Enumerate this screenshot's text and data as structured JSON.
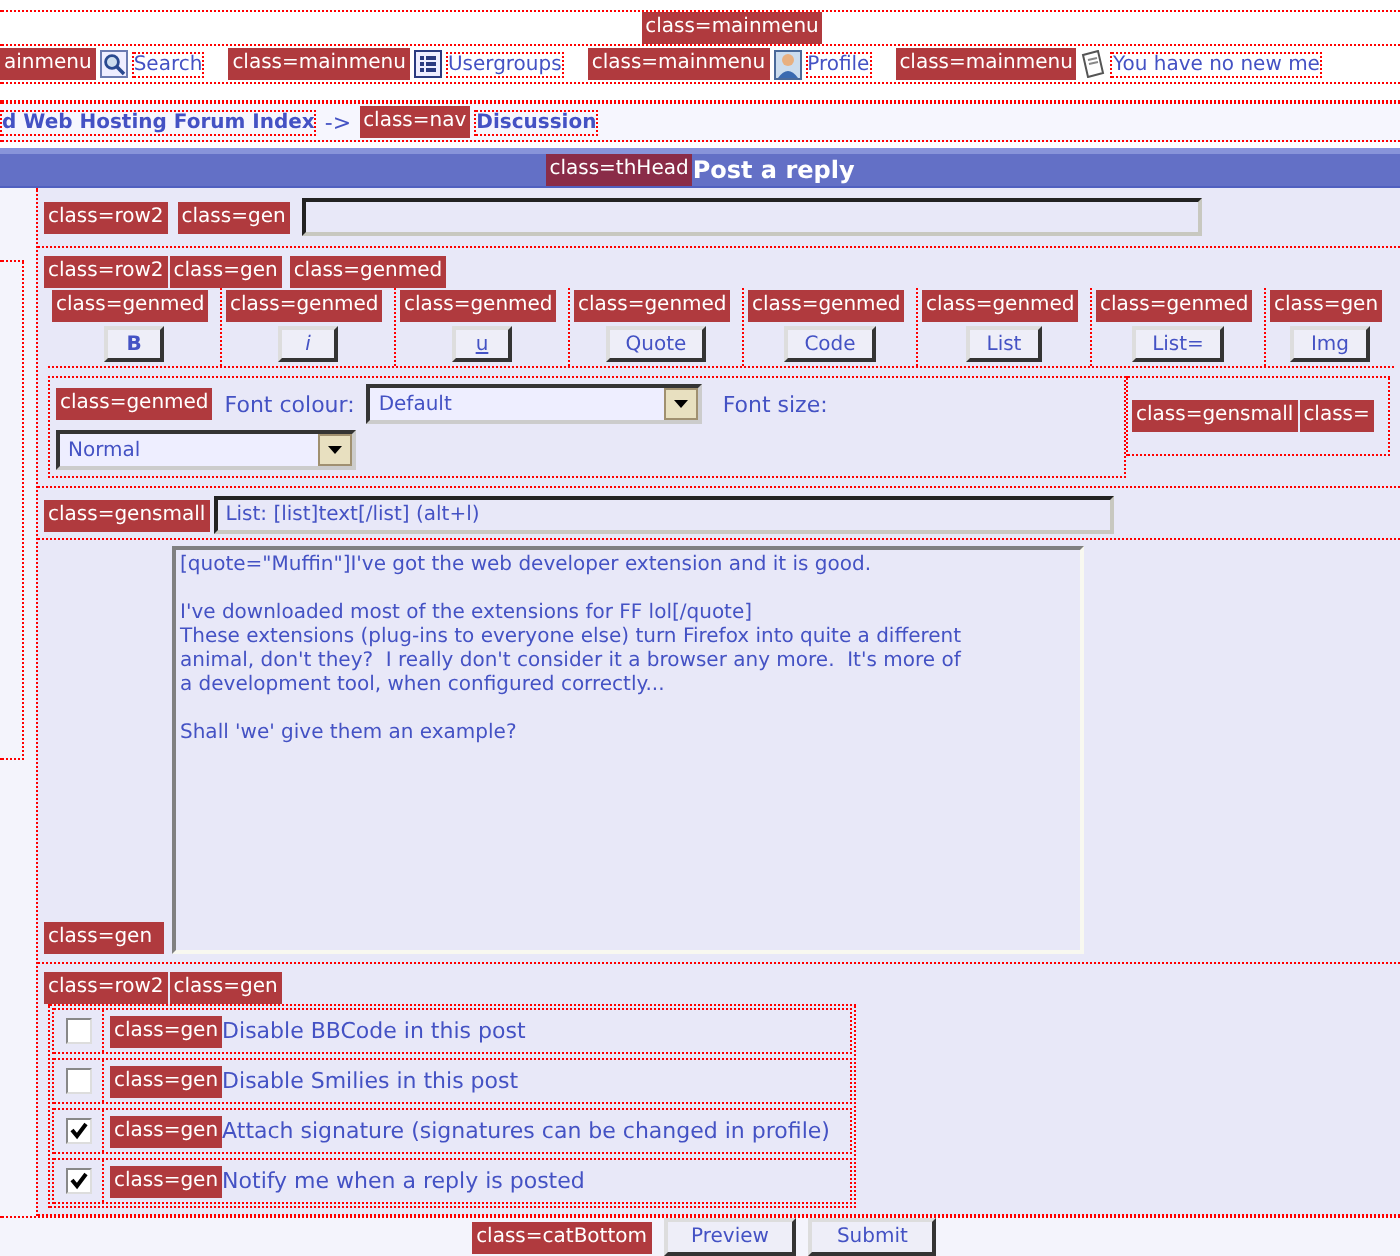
{
  "mainmenu_tag": "class=mainmenu",
  "menu_items": [
    {
      "tag": "ainmenu",
      "kind": "search",
      "text": "Search"
    },
    {
      "tag": "class=mainmenu",
      "kind": "groups",
      "text": "Usergroups"
    },
    {
      "tag": "class=mainmenu",
      "kind": "profile",
      "text": "Profile"
    },
    {
      "tag": "class=mainmenu",
      "kind": "messages",
      "text": "You have no new me"
    }
  ],
  "breadcrumb": {
    "index_link": "d Web Hosting Forum Index",
    "separator": "->",
    "tag": "class=nav",
    "current_link": "Discussion"
  },
  "header": {
    "tag": "class=thHead",
    "title": "Post a reply"
  },
  "subject_row": {
    "tags": [
      "class=row2",
      "class=gen"
    ]
  },
  "bbcode": {
    "row_tags": [
      "class=row2",
      "class=gen"
    ],
    "tag": "class=genmed",
    "buttons": [
      {
        "tag": "class=genmed",
        "label": "B",
        "kind": "bold"
      },
      {
        "tag": "class=genmed",
        "label": "i",
        "kind": "italic"
      },
      {
        "tag": "class=genmed",
        "label": "u",
        "kind": "underline"
      },
      {
        "tag": "class=genmed",
        "label": "Quote",
        "kind": "plain"
      },
      {
        "tag": "class=genmed",
        "label": "Code",
        "kind": "plain"
      },
      {
        "tag": "class=genmed",
        "label": "List",
        "kind": "plain"
      },
      {
        "tag": "class=genmed",
        "label": "List=",
        "kind": "plain"
      },
      {
        "tag": "class=gen",
        "label": "Img",
        "kind": "plain"
      }
    ]
  },
  "font_row": {
    "tag": "class=genmed",
    "colour_label": "Font colour:",
    "colour_value": "Default",
    "size_label": "Font size:",
    "size_value": "Normal",
    "side_tags": [
      "class=gensmall",
      "class="
    ]
  },
  "help_row": {
    "tag": "class=gensmall",
    "value": "List: [list]text[/list] (alt+l)"
  },
  "message": {
    "tag": "class=gen",
    "paragraphs": [
      [
        "[quote=\"Muffin\"]I've got the web developer extension and it is good."
      ],
      [
        "I've downloaded most of the extensions for FF lol[/quote]",
        "These extensions (plug-ins to everyone else) turn Firefox into quite a different",
        "animal, don't they?  I really don't consider it a browser any more.  It's more of",
        "a development tool, when configured correctly..."
      ],
      [
        "Shall 'we' give them an example?"
      ]
    ]
  },
  "options": {
    "tags": [
      "class=row2",
      "class=gen"
    ],
    "items": [
      {
        "tag": "class=gen",
        "label": "Disable BBCode in this post",
        "checked": false
      },
      {
        "tag": "class=gen",
        "label": "Disable Smilies in this post",
        "checked": false
      },
      {
        "tag": "class=gen",
        "label": "Attach signature (signatures can be changed in profile)",
        "checked": true
      },
      {
        "tag": "class=gen",
        "label": "Notify me when a reply is posted",
        "checked": true
      }
    ]
  },
  "footer": {
    "tag": "class=catBottom",
    "buttons": [
      "Preview",
      "Submit"
    ]
  }
}
